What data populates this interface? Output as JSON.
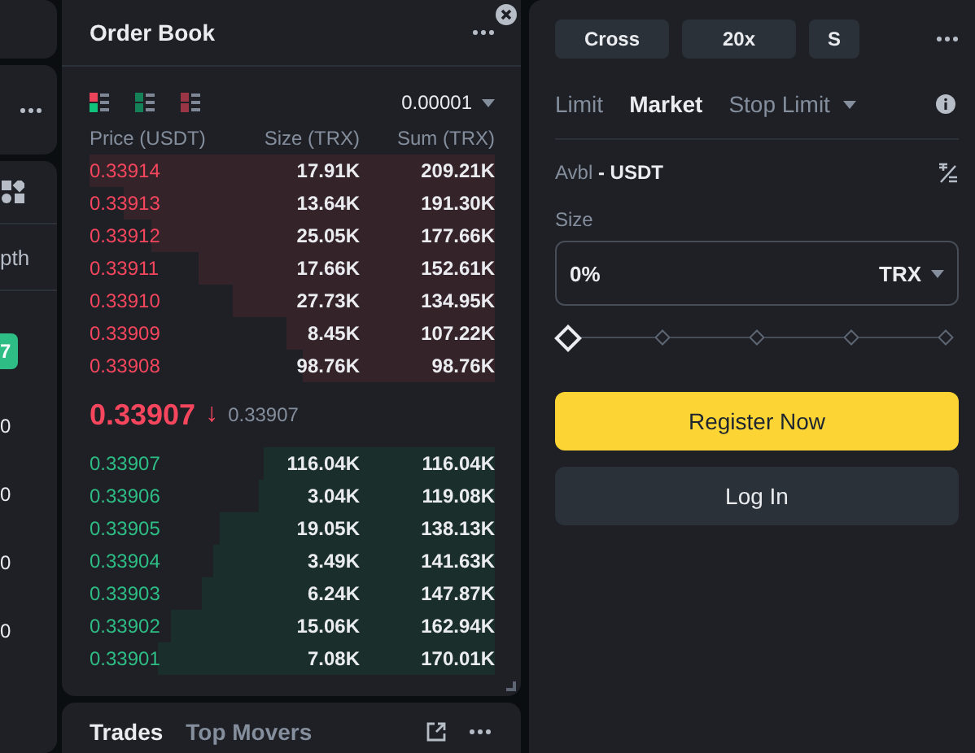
{
  "left_panel": {
    "texts": [
      "pth",
      "0",
      "0",
      "0",
      "0"
    ],
    "badge": "7"
  },
  "order_book": {
    "title": "Order Book",
    "views": [
      {
        "kind": "both",
        "selected": true
      },
      {
        "kind": "bids",
        "selected": false
      },
      {
        "kind": "asks",
        "selected": false
      }
    ],
    "precision": "0.00001",
    "columns": [
      "Price (USDT)",
      "Size (TRX)",
      "Sum (TRX)"
    ],
    "asks": [
      {
        "price": "0.33914",
        "size": "17.91K",
        "sum": "209.21K"
      },
      {
        "price": "0.33913",
        "size": "13.64K",
        "sum": "191.30K"
      },
      {
        "price": "0.33912",
        "size": "25.05K",
        "sum": "177.66K"
      },
      {
        "price": "0.33911",
        "size": "17.66K",
        "sum": "152.61K"
      },
      {
        "price": "0.33910",
        "size": "27.73K",
        "sum": "134.95K"
      },
      {
        "price": "0.33909",
        "size": "8.45K",
        "sum": "107.22K"
      },
      {
        "price": "0.33908",
        "size": "98.76K",
        "sum": "98.76K"
      }
    ],
    "last_price": "0.33907",
    "last_arrow": "↓",
    "mark_price": "0.33907",
    "bids": [
      {
        "price": "0.33907",
        "size": "116.04K",
        "sum": "116.04K"
      },
      {
        "price": "0.33906",
        "size": "3.04K",
        "sum": "119.08K"
      },
      {
        "price": "0.33905",
        "size": "19.05K",
        "sum": "138.13K"
      },
      {
        "price": "0.33904",
        "size": "3.49K",
        "sum": "141.63K"
      },
      {
        "price": "0.33903",
        "size": "6.24K",
        "sum": "147.87K"
      },
      {
        "price": "0.33902",
        "size": "15.06K",
        "sum": "162.94K"
      },
      {
        "price": "0.33901",
        "size": "7.08K",
        "sum": "170.01K"
      }
    ]
  },
  "trades_panel": {
    "tabs": [
      {
        "label": "Trades",
        "selected": true
      },
      {
        "label": "Top Movers",
        "selected": false
      }
    ]
  },
  "order_form": {
    "chips": [
      "Cross",
      "20x",
      "S"
    ],
    "tabs": [
      {
        "label": "Limit",
        "selected": false,
        "dropdown": false
      },
      {
        "label": "Market",
        "selected": true,
        "dropdown": false
      },
      {
        "label": "Stop Limit",
        "selected": false,
        "dropdown": true
      }
    ],
    "avbl_label": "Avbl",
    "avbl_value": "- USDT",
    "size_label": "Size",
    "size_value": "0%",
    "size_unit": "TRX",
    "slider": {
      "level": 0
    },
    "buttons": [
      {
        "label": "Register Now",
        "kind": "primary"
      },
      {
        "label": "Log In",
        "kind": "secondary"
      }
    ]
  }
}
